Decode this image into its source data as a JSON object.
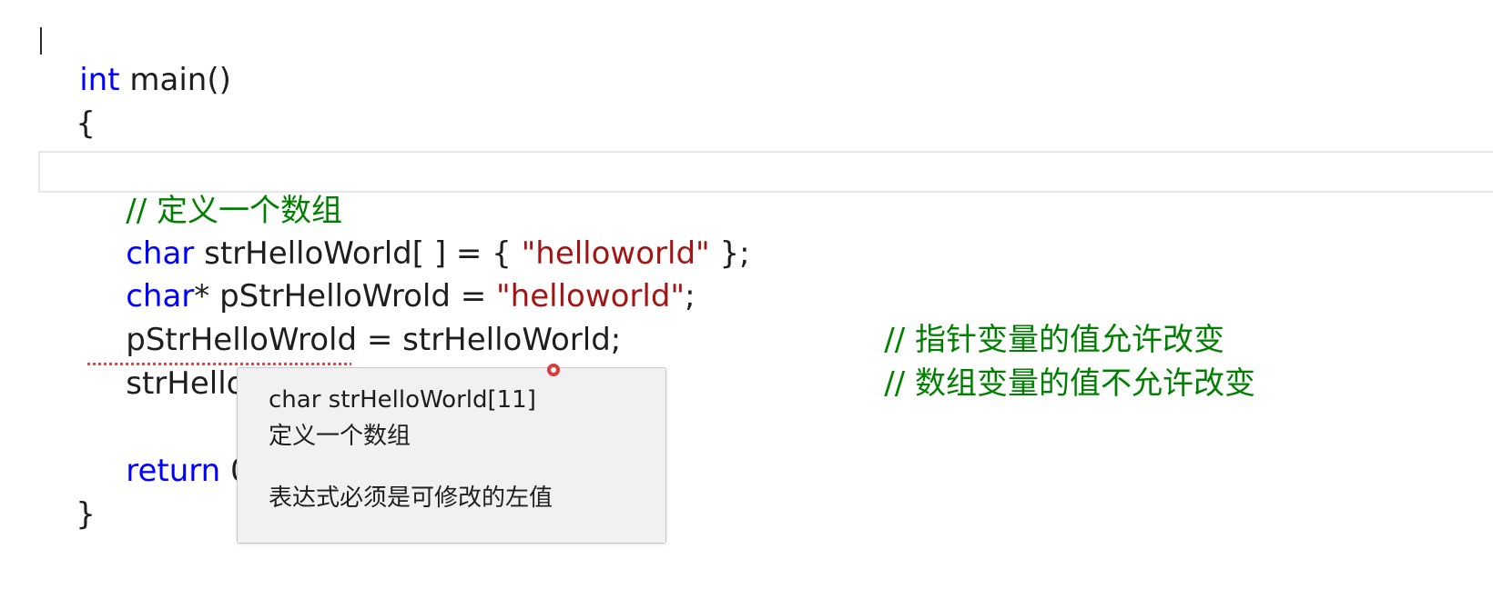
{
  "editor": {
    "lines": {
      "l1": {
        "kw": "int",
        "rest": " main()"
      },
      "l2": {
        "text": "{"
      },
      "l4": {
        "comment": "// 定义一个数组"
      },
      "l5": {
        "kw": "char",
        "mid": " strHelloWorld[ ] = { ",
        "str": "\"helloworld\"",
        "end": " };"
      },
      "l6": {
        "kw": "char",
        "mid": "* pStrHelloWrold = ",
        "str": "\"helloworld\"",
        "end": ";"
      },
      "l7": {
        "code": "pStrHelloWrold = strHelloWorld;",
        "comment": "// 指针变量的值允许改变"
      },
      "l8": {
        "code": "strHelloWorld = pStrHelloWrold;",
        "comment": "// 数组变量的值不允许改变"
      },
      "l10": {
        "kw": "return",
        "rest": " 0"
      },
      "l11": {
        "text": "}"
      }
    }
  },
  "tooltip": {
    "signature": "char strHelloWorld[11]",
    "description": "定义一个数组",
    "error": "表达式必须是可修改的左值"
  },
  "colors": {
    "keyword": "#0000ff",
    "string": "#a31515",
    "comment": "#008000",
    "squiggle": "#e04848"
  }
}
